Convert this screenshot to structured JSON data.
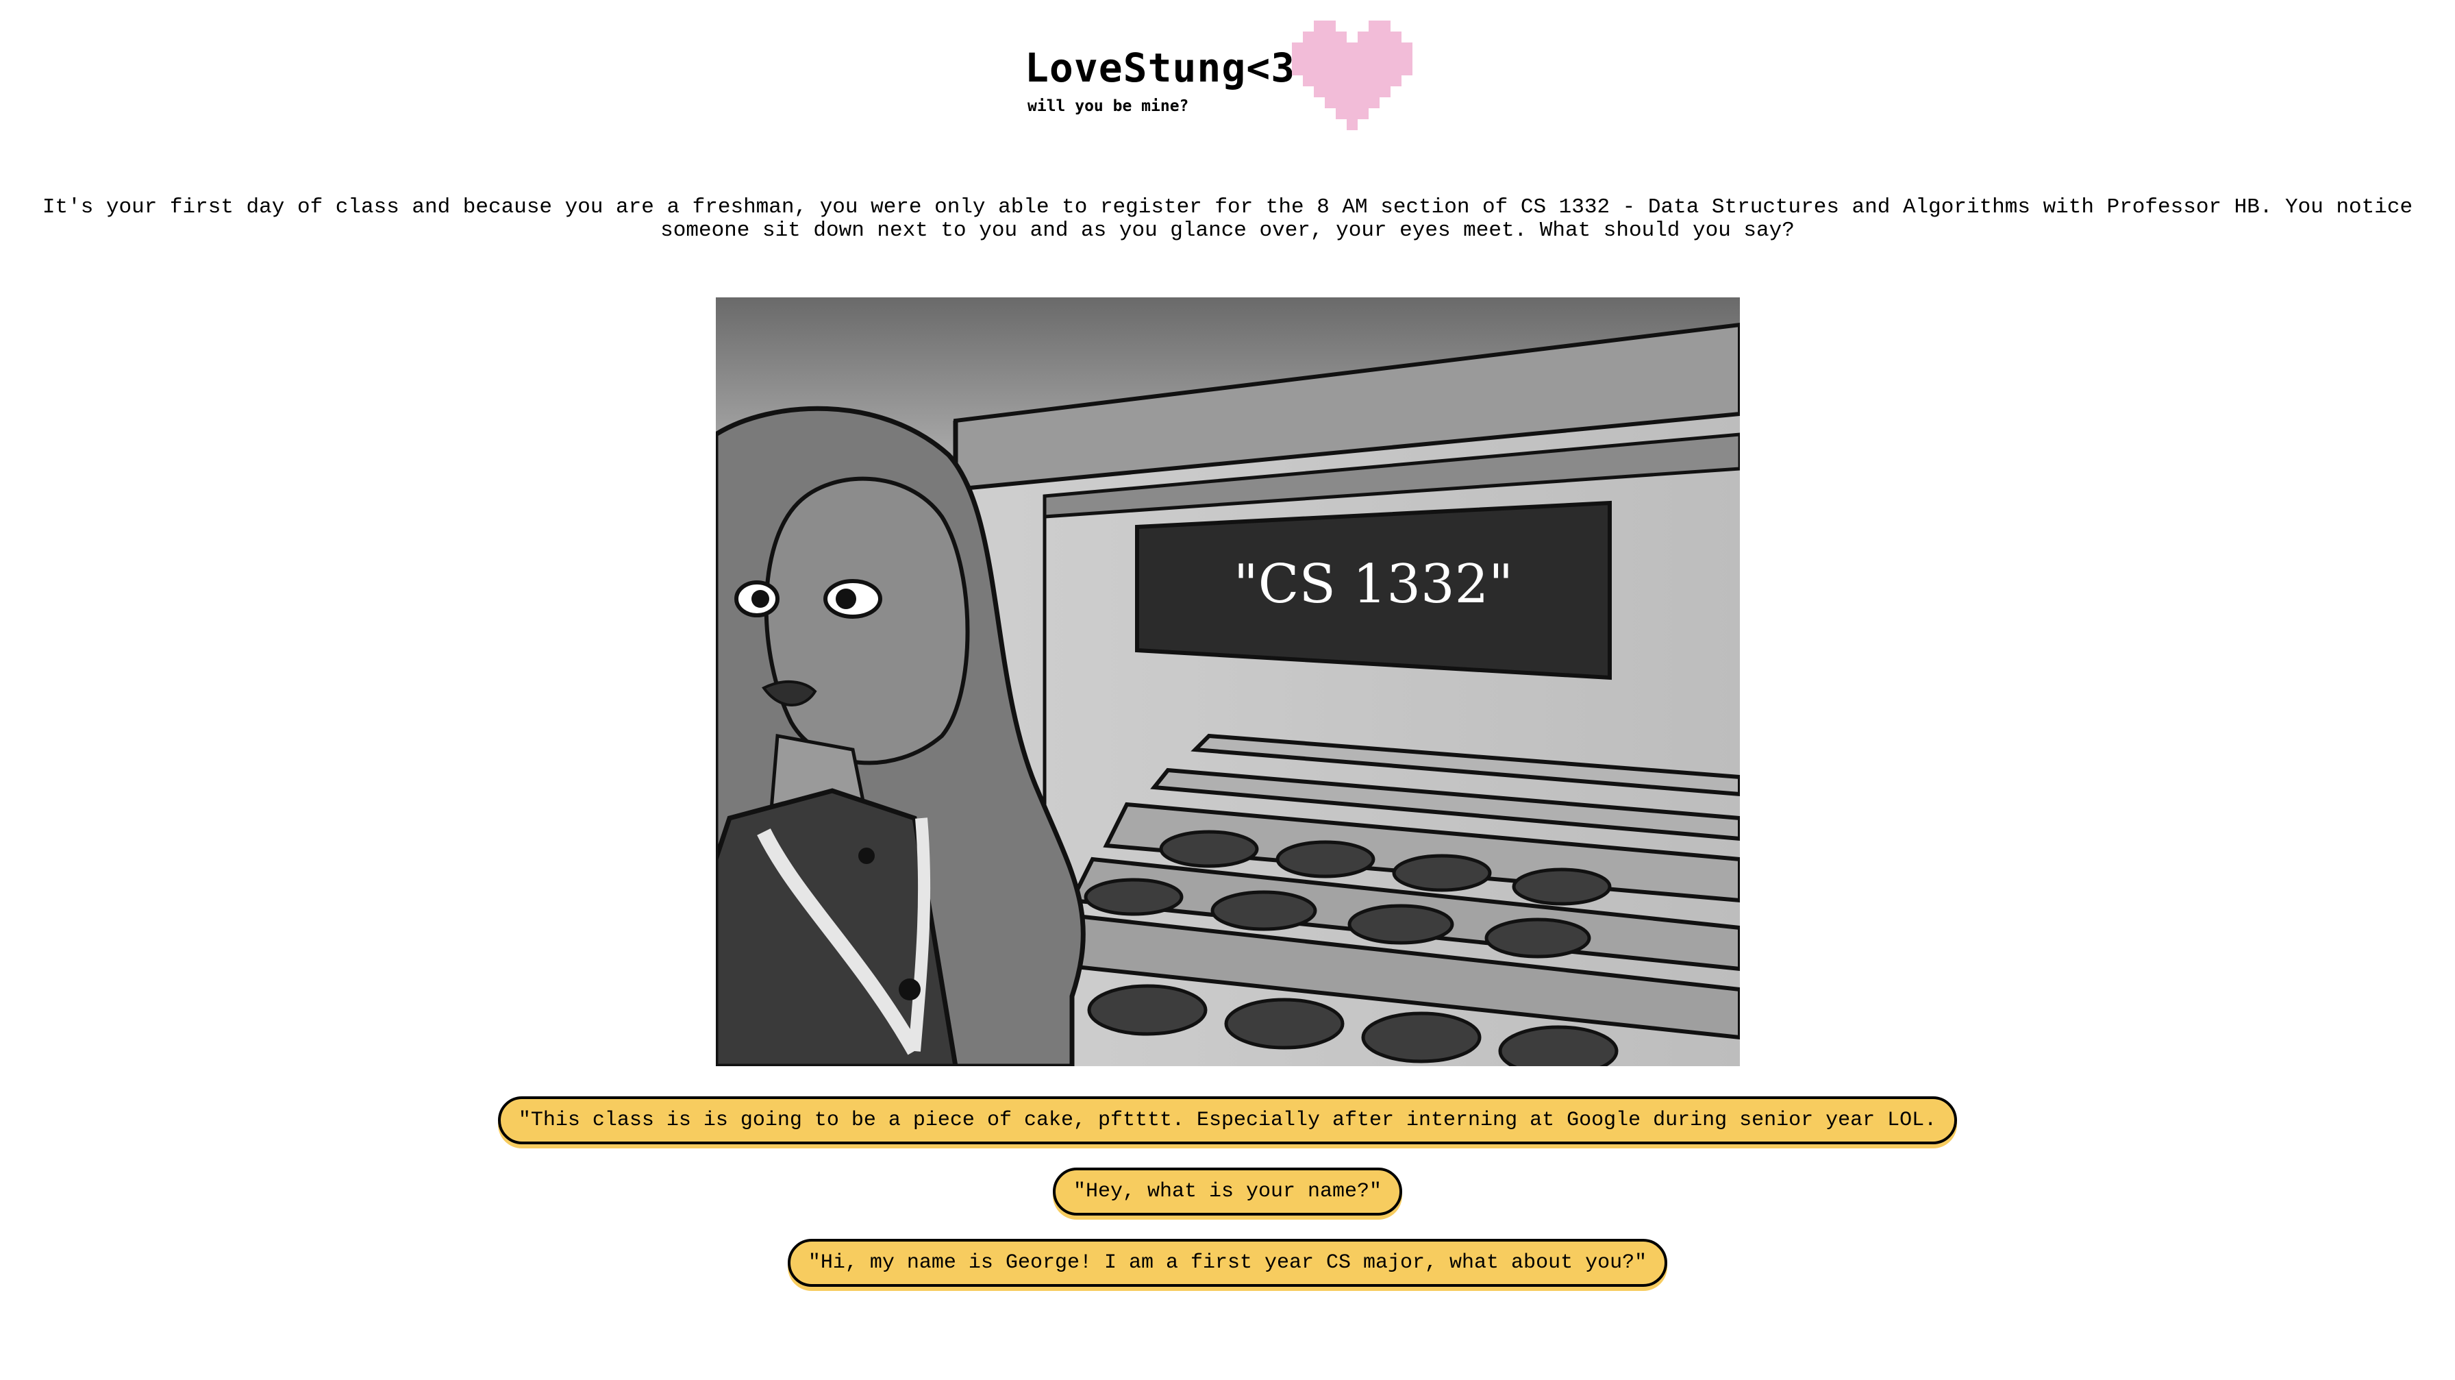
{
  "header": {
    "logo_title": "LoveStung<3",
    "logo_subtitle": "will you be mine?",
    "heart_color": "#f2bcd8",
    "heart_icon": "pixel-heart-icon"
  },
  "story": {
    "text": "It's your first day of class and because you are a freshman, you were only able to register for the 8 AM section of CS 1332 - Data Structures and Algorithms with Professor HB. You notice someone sit down next to you and as you glance over, your eyes meet. What should you say?"
  },
  "scene": {
    "chalkboard_text": "\"CS 1332\""
  },
  "choices": [
    {
      "label": "\"This class is is going to be a piece of cake, pftttt. Especially after interning at Google during senior year LOL."
    },
    {
      "label": "\"Hey, what is your name?\""
    },
    {
      "label": "\"Hi, my name is George! I am a first year CS major, what about you?\""
    }
  ],
  "colors": {
    "choice_background": "#f7cc5f",
    "choice_border": "#000000",
    "page_background": "#ffffff"
  }
}
